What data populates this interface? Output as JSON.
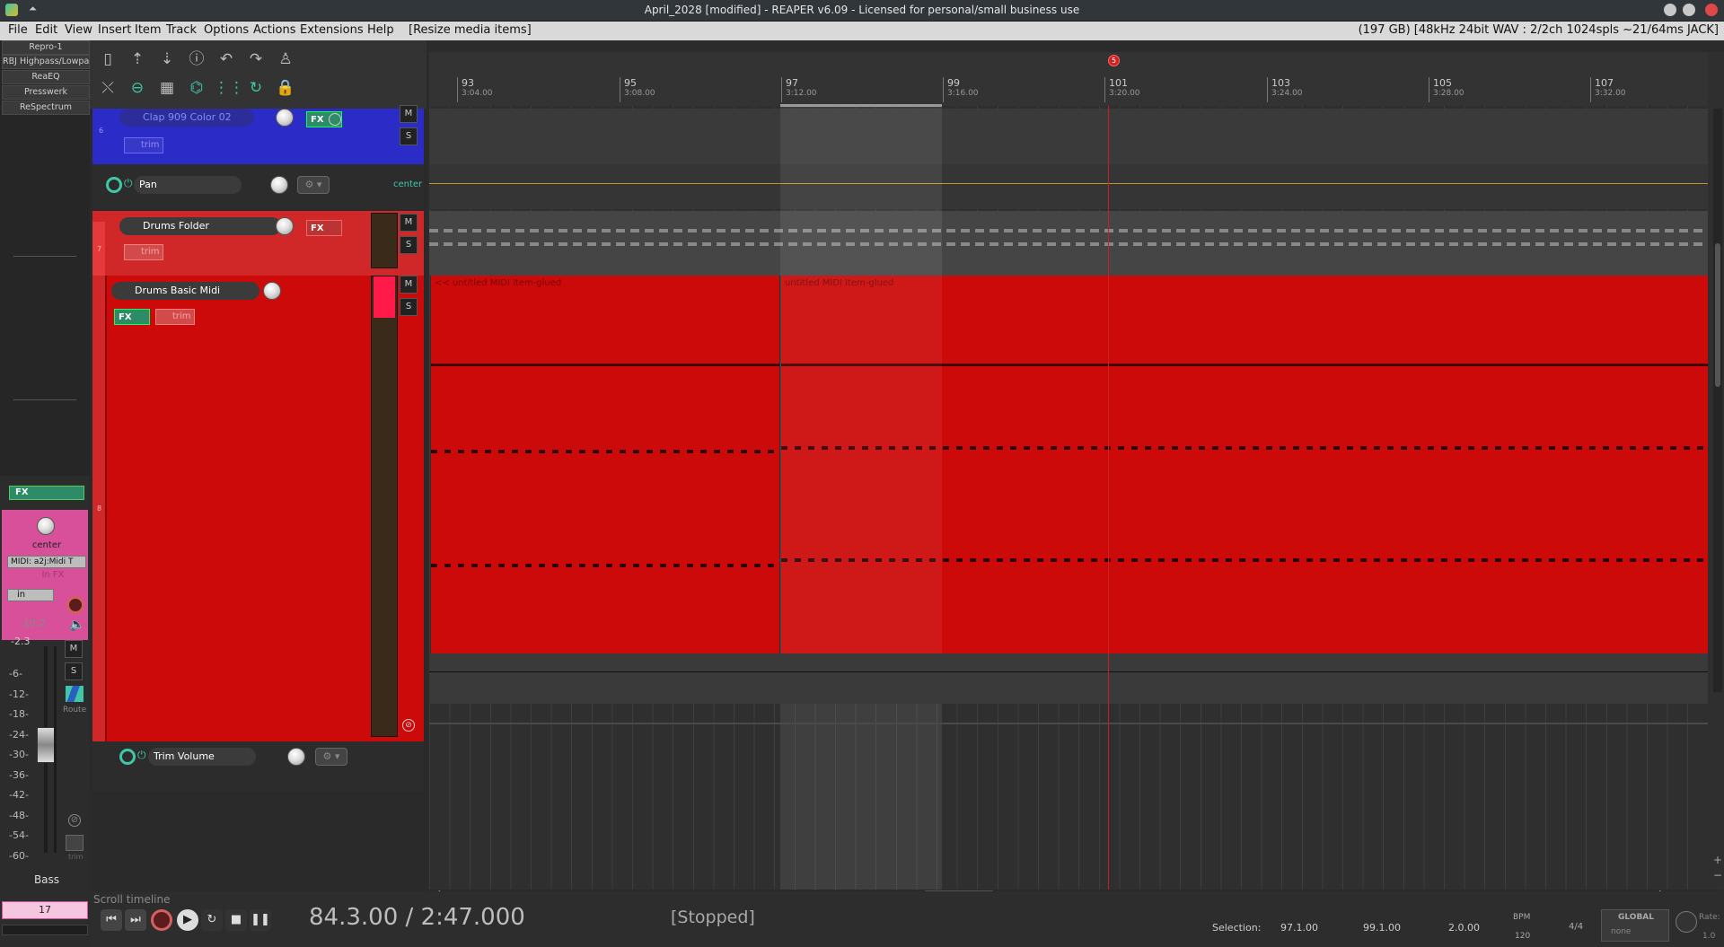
{
  "window": {
    "title": "April_2028 [modified] - REAPER v6.09 - Licensed for personal/small business use"
  },
  "menubar": {
    "items": [
      "File",
      "Edit",
      "View",
      "Insert",
      "Item",
      "Track",
      "Options",
      "Actions",
      "Extensions",
      "Help"
    ],
    "action_status": "[Resize media items]",
    "audio_status": "(197 GB) [48kHz 24bit WAV : 2/2ch 1024spls ~21/64ms JACK]"
  },
  "fx_list": [
    "Repro-1",
    "RBJ Highpass/Lowpass",
    "ReaEQ",
    "Presswerk",
    "ReSpectrum"
  ],
  "mixer": {
    "fx_label": "FX",
    "pan_label": "center",
    "midi_input": "MIDI: a2j:Midi T",
    "in_fx": "In FX",
    "input_mode": "in",
    "peak": "-10.2",
    "volume": "-2.3",
    "scale": [
      "-6-",
      "-12-",
      "-18-",
      "-24-",
      "-30-",
      "-36-",
      "-42-",
      "-48-",
      "-54-",
      "-60-"
    ],
    "mute": "M",
    "solo": "S",
    "route": "Route",
    "trim": "trim",
    "track_name": "Bass",
    "track_number": "17"
  },
  "tracks": [
    {
      "number": "6",
      "name": "Clap 909 Color 02",
      "fx": "FX",
      "trim": "trim",
      "mute": "M",
      "solo": "S",
      "color": "#2b2bc7"
    },
    {
      "envelope": "Pan",
      "value": "center"
    },
    {
      "number": "7",
      "name": "Drums Folder",
      "fx": "FX",
      "trim": "trim",
      "mute": "M",
      "solo": "S",
      "color": "#d02828"
    },
    {
      "number": "8",
      "name": "Drums Basic Midi",
      "fx": "FX",
      "trim": "trim",
      "mute": "M",
      "solo": "S",
      "color": "#cc0a0a"
    },
    {
      "envelope": "Trim Volume"
    }
  ],
  "ruler": {
    "marker": "5",
    "bars": [
      {
        "bar": "93",
        "time": "3:04.00"
      },
      {
        "bar": "95",
        "time": "3:08.00"
      },
      {
        "bar": "97",
        "time": "3:12.00"
      },
      {
        "bar": "99",
        "time": "3:16.00"
      },
      {
        "bar": "101",
        "time": "3:20.00"
      },
      {
        "bar": "103",
        "time": "3:24.00"
      },
      {
        "bar": "105",
        "time": "3:28.00"
      },
      {
        "bar": "107",
        "time": "3:32.00"
      }
    ]
  },
  "items": [
    {
      "label": "<< untitled MIDI item-glued"
    },
    {
      "label": "untitled MIDI item-glued"
    }
  ],
  "transport": {
    "scroll_hint": "Scroll timeline",
    "position": "84.3.00 / 2:47.000",
    "state": "[Stopped]",
    "selection_label": "Selection:",
    "sel_start": "97.1.00",
    "sel_end": "99.1.00",
    "sel_len": "2.0.00",
    "bpm_label": "BPM",
    "bpm": "120",
    "timesig": "4/4",
    "global": "GLOBAL",
    "none": "none",
    "rate_label": "Rate:",
    "rate": "1.0"
  },
  "colors": {
    "item_red": "#cc0a0a",
    "folder_red": "#d02828",
    "clap_blue": "#2b2bc7",
    "accent_teal": "#3fc7a8",
    "playhead": "#cc2020"
  }
}
